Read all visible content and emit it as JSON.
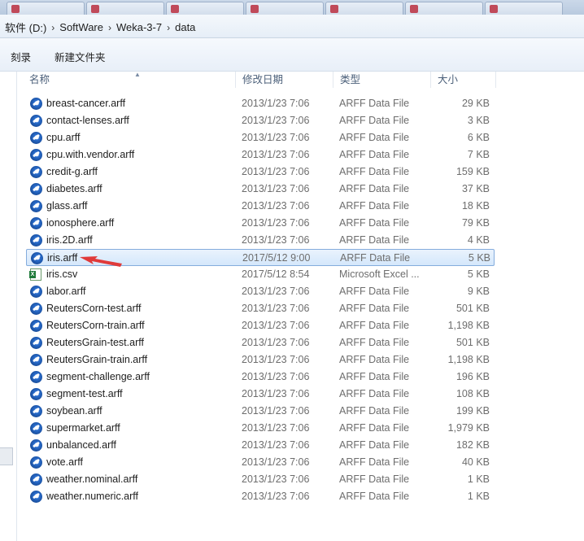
{
  "address": {
    "crumbs": [
      "软件 (D:)",
      "SoftWare",
      "Weka-3-7",
      "data"
    ]
  },
  "toolbar": {
    "burn_label": "刻录",
    "new_folder_label": "新建文件夹"
  },
  "columns": {
    "name": "名称",
    "date": "修改日期",
    "type": "类型",
    "size": "大小"
  },
  "files": [
    {
      "name": "breast-cancer.arff",
      "date": "2013/1/23 7:06",
      "type": "ARFF Data File",
      "size": "29 KB",
      "icon": "weka-arff-icon"
    },
    {
      "name": "contact-lenses.arff",
      "date": "2013/1/23 7:06",
      "type": "ARFF Data File",
      "size": "3 KB",
      "icon": "weka-arff-icon"
    },
    {
      "name": "cpu.arff",
      "date": "2013/1/23 7:06",
      "type": "ARFF Data File",
      "size": "6 KB",
      "icon": "weka-arff-icon"
    },
    {
      "name": "cpu.with.vendor.arff",
      "date": "2013/1/23 7:06",
      "type": "ARFF Data File",
      "size": "7 KB",
      "icon": "weka-arff-icon"
    },
    {
      "name": "credit-g.arff",
      "date": "2013/1/23 7:06",
      "type": "ARFF Data File",
      "size": "159 KB",
      "icon": "weka-arff-icon"
    },
    {
      "name": "diabetes.arff",
      "date": "2013/1/23 7:06",
      "type": "ARFF Data File",
      "size": "37 KB",
      "icon": "weka-arff-icon"
    },
    {
      "name": "glass.arff",
      "date": "2013/1/23 7:06",
      "type": "ARFF Data File",
      "size": "18 KB",
      "icon": "weka-arff-icon"
    },
    {
      "name": "ionosphere.arff",
      "date": "2013/1/23 7:06",
      "type": "ARFF Data File",
      "size": "79 KB",
      "icon": "weka-arff-icon"
    },
    {
      "name": "iris.2D.arff",
      "date": "2013/1/23 7:06",
      "type": "ARFF Data File",
      "size": "4 KB",
      "icon": "weka-arff-icon"
    },
    {
      "name": "iris.arff",
      "date": "2017/5/12 9:00",
      "type": "ARFF Data File",
      "size": "5 KB",
      "icon": "weka-arff-icon",
      "selected": true
    },
    {
      "name": "iris.csv",
      "date": "2017/5/12 8:54",
      "type": "Microsoft Excel ...",
      "size": "5 KB",
      "icon": "excel-csv-icon"
    },
    {
      "name": "labor.arff",
      "date": "2013/1/23 7:06",
      "type": "ARFF Data File",
      "size": "9 KB",
      "icon": "weka-arff-icon"
    },
    {
      "name": "ReutersCorn-test.arff",
      "date": "2013/1/23 7:06",
      "type": "ARFF Data File",
      "size": "501 KB",
      "icon": "weka-arff-icon"
    },
    {
      "name": "ReutersCorn-train.arff",
      "date": "2013/1/23 7:06",
      "type": "ARFF Data File",
      "size": "1,198 KB",
      "icon": "weka-arff-icon"
    },
    {
      "name": "ReutersGrain-test.arff",
      "date": "2013/1/23 7:06",
      "type": "ARFF Data File",
      "size": "501 KB",
      "icon": "weka-arff-icon"
    },
    {
      "name": "ReutersGrain-train.arff",
      "date": "2013/1/23 7:06",
      "type": "ARFF Data File",
      "size": "1,198 KB",
      "icon": "weka-arff-icon"
    },
    {
      "name": "segment-challenge.arff",
      "date": "2013/1/23 7:06",
      "type": "ARFF Data File",
      "size": "196 KB",
      "icon": "weka-arff-icon"
    },
    {
      "name": "segment-test.arff",
      "date": "2013/1/23 7:06",
      "type": "ARFF Data File",
      "size": "108 KB",
      "icon": "weka-arff-icon"
    },
    {
      "name": "soybean.arff",
      "date": "2013/1/23 7:06",
      "type": "ARFF Data File",
      "size": "199 KB",
      "icon": "weka-arff-icon"
    },
    {
      "name": "supermarket.arff",
      "date": "2013/1/23 7:06",
      "type": "ARFF Data File",
      "size": "1,979 KB",
      "icon": "weka-arff-icon"
    },
    {
      "name": "unbalanced.arff",
      "date": "2013/1/23 7:06",
      "type": "ARFF Data File",
      "size": "182 KB",
      "icon": "weka-arff-icon"
    },
    {
      "name": "vote.arff",
      "date": "2013/1/23 7:06",
      "type": "ARFF Data File",
      "size": "40 KB",
      "icon": "weka-arff-icon"
    },
    {
      "name": "weather.nominal.arff",
      "date": "2013/1/23 7:06",
      "type": "ARFF Data File",
      "size": "1 KB",
      "icon": "weka-arff-icon"
    },
    {
      "name": "weather.numeric.arff",
      "date": "2013/1/23 7:06",
      "type": "ARFF Data File",
      "size": "1 KB",
      "icon": "weka-arff-icon"
    }
  ],
  "colors": {
    "annotation_arrow": "#e03a3a",
    "selection_border": "#84acdd",
    "header_text": "#4c607a"
  }
}
